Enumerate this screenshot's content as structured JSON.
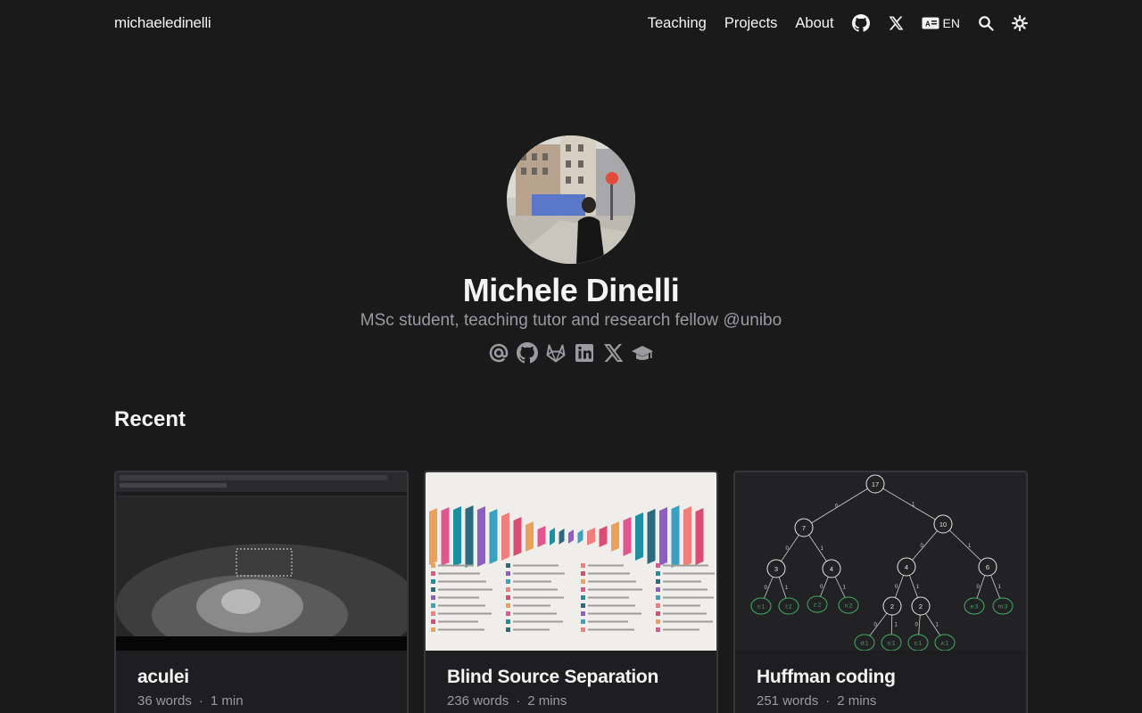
{
  "header": {
    "brand": "michaeledinelli",
    "nav": [
      {
        "label": "Teaching"
      },
      {
        "label": "Projects"
      },
      {
        "label": "About"
      }
    ],
    "lang": "EN"
  },
  "hero": {
    "name": "Michele Dinelli",
    "tagline": "MSc student, teaching tutor and research fellow @unibo"
  },
  "recent": {
    "title": "Recent",
    "cards": [
      {
        "title": "aculei",
        "words": "36 words",
        "time": "1 min"
      },
      {
        "title": "Blind Source Separation",
        "words": "236 words",
        "time": "2 mins"
      },
      {
        "title": "Huffman coding",
        "words": "251 words",
        "time": "2 mins"
      }
    ]
  },
  "huffman_tree": {
    "nodes": [
      "17",
      "7",
      "10",
      "3",
      "4",
      "4",
      "6",
      "2",
      "2"
    ],
    "leaves": [
      "s:1",
      "t:2",
      "z:2",
      "n:2",
      "e:3",
      "m:3",
      "d:1",
      "o:1",
      "c:1",
      "x:1"
    ],
    "edge_labels": [
      "0",
      "1"
    ]
  },
  "colors": {
    "background": "#1a1a1b",
    "text": "#f4f4f5",
    "muted": "#9a9aa0",
    "card_border": "#36363a",
    "leaf_green": "#3fae5f"
  },
  "icons": {
    "nav": [
      "github-icon",
      "x-icon",
      "language-icon",
      "search-icon",
      "theme-toggle-icon"
    ],
    "socials": [
      "email-icon",
      "github-icon",
      "gitlab-icon",
      "linkedin-icon",
      "x-icon",
      "scholar-icon"
    ]
  }
}
